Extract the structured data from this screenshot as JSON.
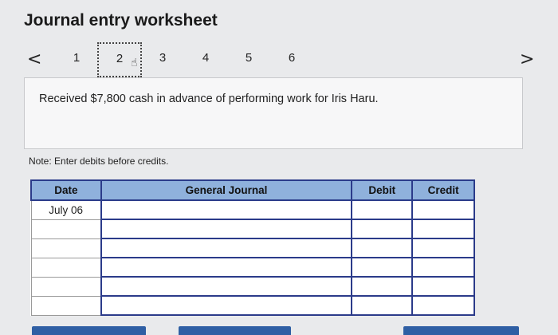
{
  "title": "Journal entry worksheet",
  "pager": {
    "prev": "<",
    "next": ">",
    "pages": [
      "1",
      "2",
      "3",
      "4",
      "5",
      "6"
    ],
    "active_page": "2"
  },
  "question": "Received $7,800 cash in advance of performing work for Iris Haru.",
  "note": "Note: Enter debits before credits.",
  "journal": {
    "headers": {
      "date": "Date",
      "general_journal": "General Journal",
      "debit": "Debit",
      "credit": "Credit"
    },
    "rows": [
      {
        "date": "July 06",
        "account": "",
        "debit": "",
        "credit": ""
      },
      {
        "date": "",
        "account": "",
        "debit": "",
        "credit": ""
      },
      {
        "date": "",
        "account": "",
        "debit": "",
        "credit": ""
      },
      {
        "date": "",
        "account": "",
        "debit": "",
        "credit": ""
      },
      {
        "date": "",
        "account": "",
        "debit": "",
        "credit": ""
      },
      {
        "date": "",
        "account": "",
        "debit": "",
        "credit": ""
      }
    ]
  },
  "colors": {
    "header_bg": "#8fb1dc",
    "input_border": "#2b3b8a",
    "button": "#2f5fa4"
  }
}
